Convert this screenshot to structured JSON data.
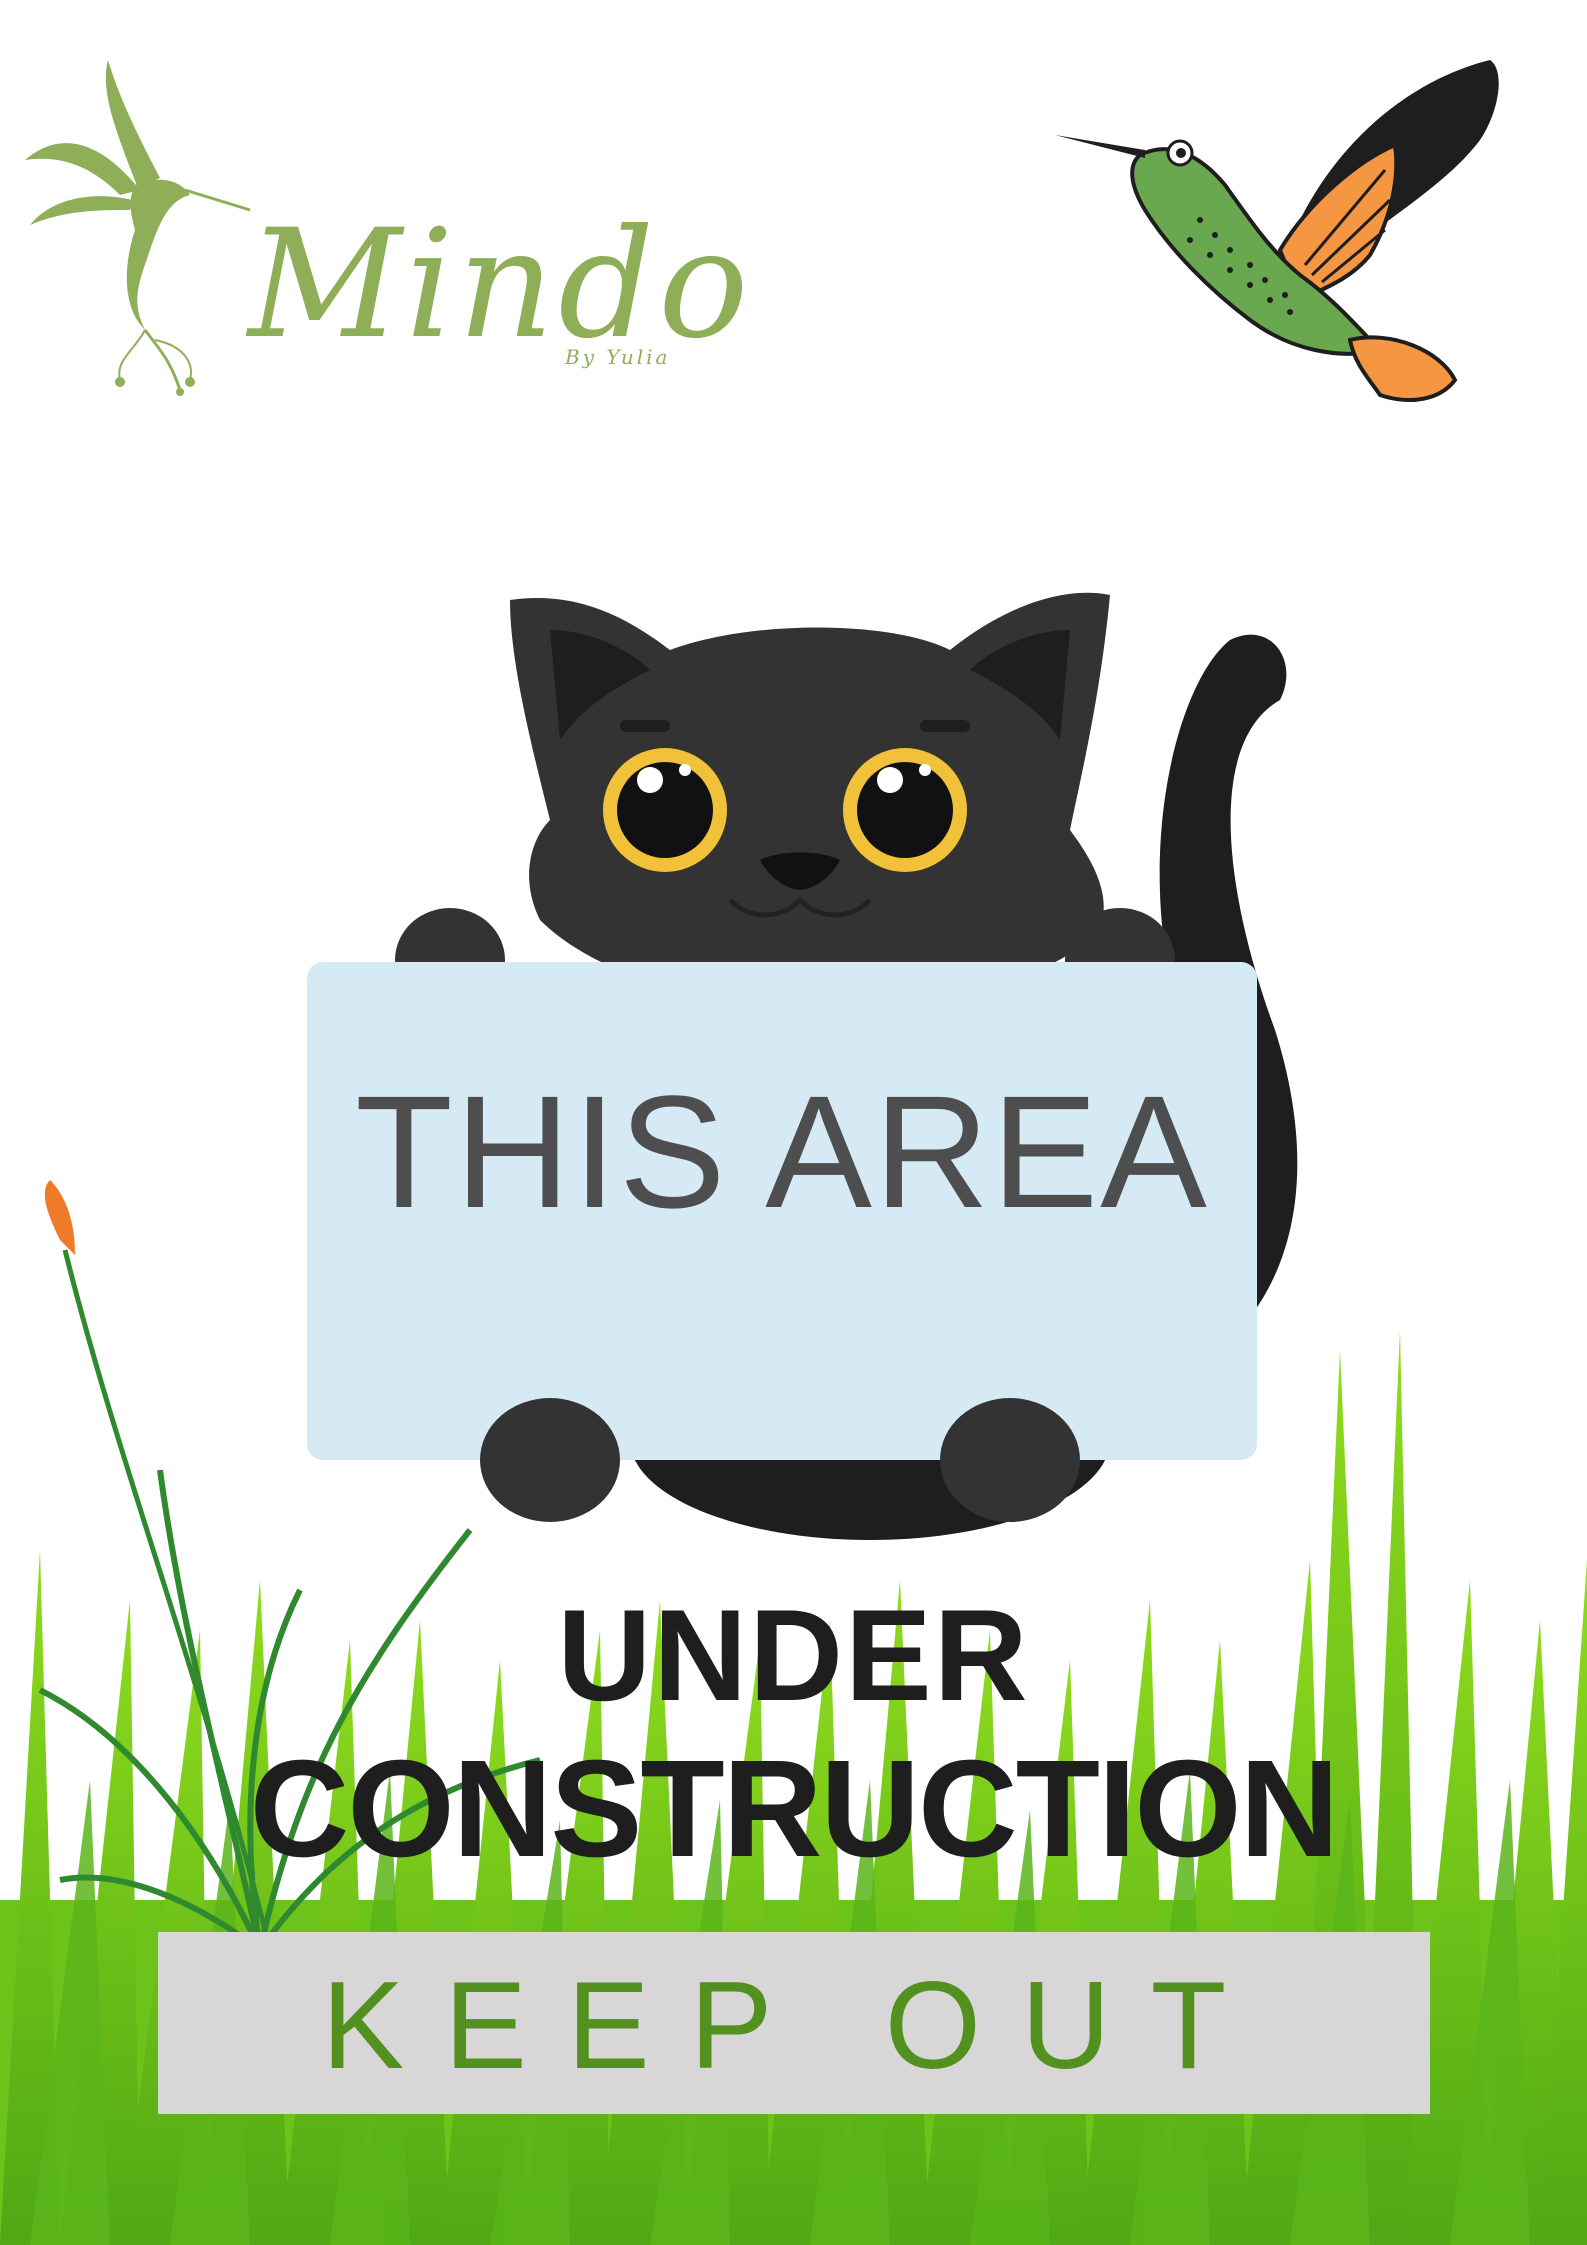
{
  "logo": {
    "wordmark": "Mindo",
    "byline": "By Yulia",
    "color": "#8fae58"
  },
  "sign": {
    "text": "THIS AREA",
    "background": "#d6eaf5",
    "text_color": "#4e4e4e"
  },
  "headline": {
    "line1": "UNDER",
    "line2": "CONSTRUCTION",
    "color": "#1e1e1e"
  },
  "banner": {
    "text": "KEEP OUT",
    "background": "#d8d6d6",
    "text_color": "#52911f"
  },
  "illustrations": {
    "logo_bird": "hummingbird-logo-icon",
    "bird": "hummingbird-illustration",
    "cat": "black-cat-illustration",
    "grass": "grass-illustration",
    "cattail": "cattail-illustration"
  }
}
